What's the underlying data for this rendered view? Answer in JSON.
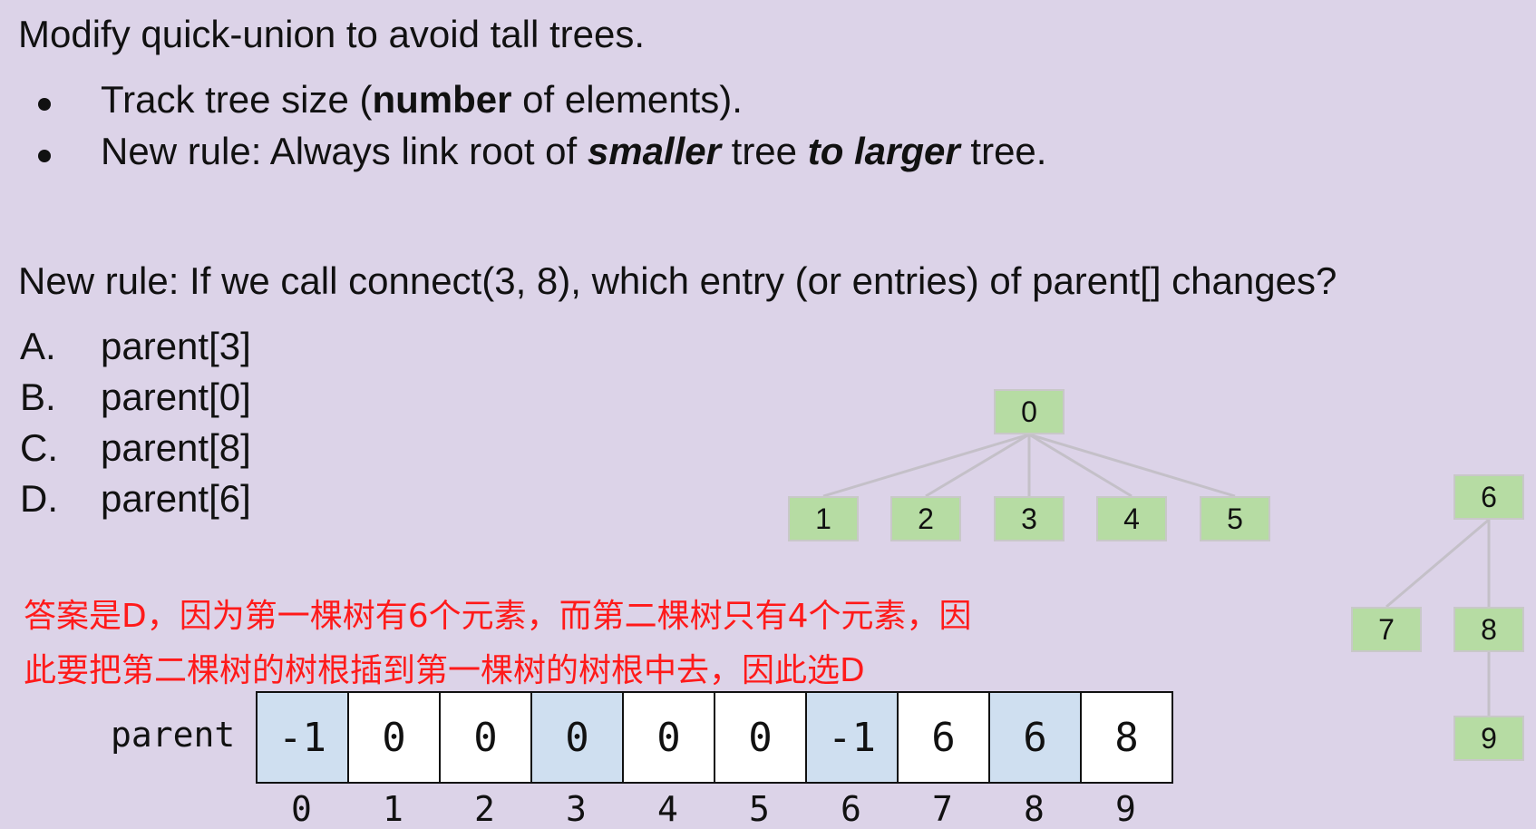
{
  "heading": "Modify quick-union to avoid tall trees.",
  "bullets": {
    "b1_pre": "Track tree size (",
    "b1_bold": "number",
    "b1_post": " of elements).",
    "b2_pre": "New rule: Always link root of ",
    "b2_em1": "smaller",
    "b2_mid": " tree ",
    "b2_em2": "to larger",
    "b2_post": " tree."
  },
  "question": "New rule: If we call connect(3, 8), which entry (or entries) of parent[] changes?",
  "options": [
    {
      "letter": "A.",
      "text": "parent[3]"
    },
    {
      "letter": "B.",
      "text": "parent[0]"
    },
    {
      "letter": "C.",
      "text": "parent[8]"
    },
    {
      "letter": "D.",
      "text": "parent[6]"
    }
  ],
  "answer": {
    "line1": "答案是D，因为第一棵树有6个元素，而第二棵树只有4个元素，因",
    "line2": "此要把第二棵树的树根插到第一棵树的树根中去，因此选D",
    "color": "#ff1a1a"
  },
  "array": {
    "label": "parent",
    "values": [
      "-1",
      "0",
      "0",
      "0",
      "0",
      "0",
      "-1",
      "6",
      "6",
      "8"
    ],
    "indices": [
      "0",
      "1",
      "2",
      "3",
      "4",
      "5",
      "6",
      "7",
      "8",
      "9"
    ],
    "highlighted": [
      0,
      3,
      6,
      8
    ],
    "highlight_color": "#cfdff0"
  },
  "trees": {
    "node_labels": [
      "0",
      "1",
      "2",
      "3",
      "4",
      "5",
      "6",
      "7",
      "8",
      "9"
    ],
    "edges": [
      [
        0,
        1
      ],
      [
        0,
        2
      ],
      [
        0,
        3
      ],
      [
        0,
        4
      ],
      [
        0,
        5
      ],
      [
        6,
        7
      ],
      [
        6,
        8
      ],
      [
        8,
        9
      ]
    ],
    "node_color": "#b6dca3"
  }
}
